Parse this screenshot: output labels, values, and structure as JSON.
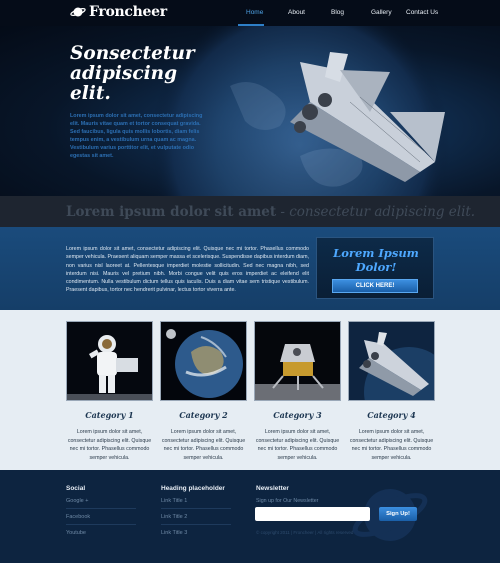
{
  "header": {
    "logo_text": "Froncheer",
    "logo_icon": "planet-icon",
    "nav": [
      "Home",
      "About",
      "Blog",
      "Gallery",
      "Contact Us"
    ],
    "active_nav": "Home",
    "accent_color": "#4fa3e6"
  },
  "hero": {
    "title_line1": "Sonsectetur",
    "title_line2": "adipiscing",
    "title_line3": "elit.",
    "description": "Lorem ipsum dolor sit amet, consectetur adipiscing elit. Mauris vitae quam et tortor consequat gravida. Sed faucibus, ligula quis mollis lobortis, diam felis tempus enim, a vestibulum urna quam ac magna. Vestibulum varius porttitor elit, et vulputate odio egestas sit amet."
  },
  "band": {
    "bold_text": "Lorem ipsum dolor sit amet",
    "separator": " - ",
    "italic_text": "consectetur adipiscing elit."
  },
  "intro": {
    "text": "Lorem ipsum dolor sit amet, consectetur adipiscing elit. Quisque nec mi tortor. Phasellus commodo semper vehicula. Praesent aliquam semper massa et scelerisque. Suspendisse dapibus interdum diam, non varius nisl laoreet at. Pellentesque imperdiet molestie sollicitudin. Sed nec magna nibh, sed interdum nisi. Mauris vel pretium nibh. Morbi congue velit quis eros imperdiet ac eleifend elit condimentum. Nulla vestibulum dictum tellus quis iaculis. Duis a diam vitae sem tristique vestibulum. Praesent dapibus, tortor nec hendrerit pulvinar, lectus tortor viverra ante.",
    "cta_title_line1": "Lorem Ipsum",
    "cta_title_line2": "Dolor!",
    "cta_button": "CLICK HERE!"
  },
  "categories": [
    {
      "title": "Category 1",
      "text": "Lorem ipsum dolor sit amet, consectetur adipiscing elit. Quisque nec mi tortor. Phasellus commodo semper vehicula."
    },
    {
      "title": "Category 2",
      "text": "Lorem ipsum dolor sit amet, consectetur adipiscing elit. Quisque nec mi tortor. Phasellus commodo semper vehicula."
    },
    {
      "title": "Category 3",
      "text": "Lorem ipsum dolor sit amet, consectetur adipiscing elit. Quisque nec mi tortor. Phasellus commodo semper vehicula."
    },
    {
      "title": "Category 4",
      "text": "Lorem ipsum dolor sit amet, consectetur adipiscing elit. Quisque nec mi tortor. Phasellus commodo semper vehicula."
    }
  ],
  "footer": {
    "social": {
      "title": "Social",
      "items": [
        "Google +",
        "Facebook",
        "Youtube"
      ]
    },
    "links": {
      "title": "Heading placeholder",
      "items": [
        "Link Title 1",
        "Link Title 2",
        "Link Title 3"
      ]
    },
    "newsletter": {
      "title": "Newsletter",
      "subtitle": "Sign up for Our Newsletter",
      "input_placeholder": "",
      "button": "Sign Up!",
      "copyright": "© copyright 2011 | Froncheer | All rights reserved"
    }
  }
}
